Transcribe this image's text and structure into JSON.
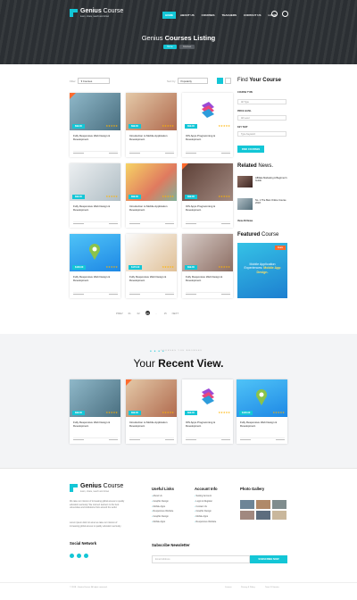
{
  "header": {
    "logo_title_bold": "Genius",
    "logo_title_light": " Course",
    "logo_tagline": "learn, share, teach and show",
    "nav": [
      "HOME",
      "ABOUT US",
      "COURSES",
      "TEACHERS",
      "CONTACT US",
      "LOGIN"
    ],
    "page_title_light": "Genius ",
    "page_title_bold": "Courses Listing",
    "breadcrumb_home": "Home",
    "breadcrumb_current": "Courses"
  },
  "filters": {
    "filter_label": "Filter",
    "category_value": "▾ Courses",
    "sort_label": "Sort by",
    "sort_value": "Popularity"
  },
  "courses": [
    {
      "title": "Fully Responsive Web Design & Development.",
      "price": "$99.00",
      "stars": "★★★★★"
    },
    {
      "title": "Introduction to Mobile Application Development.",
      "price": "$99.00",
      "stars": "★★★★★"
    },
    {
      "title": "IOS Apps Programming & Development.",
      "price": "$99.00",
      "stars": "★★★★★"
    },
    {
      "title": "Fully Responsive Web Design & Development.",
      "price": "$99.00",
      "stars": "★★★★★"
    },
    {
      "title": "Introduction to Mobile Application Development.",
      "price": "$99.00",
      "stars": "★★★★★"
    },
    {
      "title": "IOS Apps Programming & Development.",
      "price": "$99.00",
      "stars": "★★★★★"
    },
    {
      "title": "Fully Responsive Web Design & Development.",
      "price": "$130.00",
      "stars": "★★★★★"
    },
    {
      "title": "Fully Responsive Web Design & Development.",
      "price": "$170.00",
      "stars": "★★★★★"
    },
    {
      "title": "Fully Responsive Web Design & Development.",
      "price": "$99.00",
      "stars": "★★★★★"
    }
  ],
  "sidebar": {
    "find_light": "Find ",
    "find_bold": "Your Course",
    "course_type_label": "COURSE TYPE",
    "course_type_value": "All Type",
    "price_label": "PRICE LEVEL",
    "price_value": "All Level",
    "key_label": "KEY TEXT",
    "key_placeholder": "Type Keyword",
    "find_button": "FIND COURSES",
    "related_bold": "Related ",
    "related_light": "News.",
    "news": [
      "Affiliate Marketing A Beginner's Guide",
      "No. 1 The Best Online Course 2018."
    ],
    "view_all": "View All News",
    "featured_bold": "Featured ",
    "featured_light": "Course",
    "featured_badge": "Deals",
    "featured_text_1": "Mobile Application Experiences:",
    "featured_text_2": "Mobile App Design."
  },
  "pagination": {
    "prev": "PREV",
    "pages": [
      "01",
      "02",
      "03",
      "..",
      "15"
    ],
    "next": "NEXT"
  },
  "recent": {
    "kicker": "COURSES YOU BROWSED",
    "title_light": "Your ",
    "title_bold": "Recent View.",
    "items": [
      {
        "title": "Fully Responsive Web Design & Development.",
        "price": "$99.00"
      },
      {
        "title": "Introduction to Mobile Application Development.",
        "price": "$99.00"
      },
      {
        "title": "IOS Apps Programming & Development.",
        "price": "$99.00"
      },
      {
        "title": "Fully Responsive Web Design & Development.",
        "price": "$135.00"
      }
    ]
  },
  "footer": {
    "about": "We take our mission of increasing global access to quality education seriously. We connect learners to the best universities and institutions from around the world.",
    "about_2": "Lorem ipsum dolor sit amet we take our mission of increasing global access to quality education seriously.",
    "social_title": "Social Network",
    "useful_title": "Useful Links",
    "useful_links": [
      "About Us",
      "Graphic Design",
      "Mobile Apps",
      "Responsive Website",
      "Graphic Design",
      "Mobile Apps"
    ],
    "account_title": "Account Info",
    "account_links": [
      "Setting Account",
      "Login & Register",
      "Contact Us",
      "Graphic Design",
      "Mobile Apps",
      "Responsive Website"
    ],
    "gallery_title": "Photo Gallery",
    "newsletter_title": "Subscribe Newsletter",
    "newsletter_placeholder": "Email Address",
    "newsletter_button": "SUBSCRIBE NOW",
    "copyright": "© 2018 - GeniusCourse. All rights reserved.",
    "legal": [
      "License",
      "Privacy & Policy",
      "Term Of Service"
    ]
  },
  "colors": {
    "accent": "#13c6d6",
    "ribbon": "#ff6a2c",
    "dark": "#2b2f33"
  }
}
